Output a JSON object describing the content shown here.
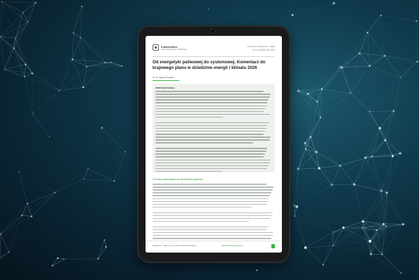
{
  "document": {
    "logo_text": "Łukasiewicz",
    "logo_sub": "Instytut Energetyki i Technologii",
    "meta_line1": "Komentarz Łukasiewicz – IREN",
    "meta_line2": "Numer 5/2026 | Maj 2026",
    "title": "Od energetyki paliwowej do systemowej. Komentarz do krajowego planu w dziedzinie energii i klimatu 2026",
    "author": "dr inż. Agata Urbańska",
    "summary_label": "WPROWADZENIE",
    "section_heading": "Od mixu paliwowego do architektury systemu",
    "footer_text": "Łukasiewicz – IREN | ul. Dworcowa 12, 00-970 Warszawa |",
    "footer_link": "https://iren.lukasiewicz.gov.pl"
  },
  "colors": {
    "accent": "#3cb54a",
    "background": "#0f3a4c",
    "bezel": "#1a1a1c"
  }
}
